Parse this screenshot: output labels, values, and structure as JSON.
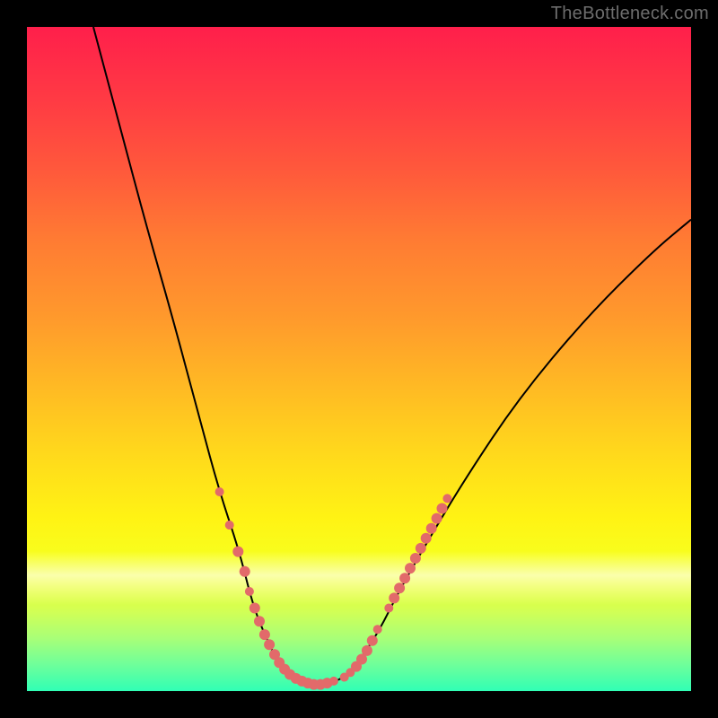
{
  "attribution": "TheBottleneck.com",
  "chart_data": {
    "type": "line",
    "title": "",
    "xlabel": "",
    "ylabel": "",
    "xlim": [
      0,
      100
    ],
    "ylim": [
      0,
      100
    ],
    "curve": {
      "name": "bottleneck-curve",
      "points": [
        {
          "x": 10,
          "y": 100
        },
        {
          "x": 14,
          "y": 85
        },
        {
          "x": 18,
          "y": 70
        },
        {
          "x": 22,
          "y": 56
        },
        {
          "x": 26,
          "y": 41
        },
        {
          "x": 29,
          "y": 30
        },
        {
          "x": 32,
          "y": 21
        },
        {
          "x": 34,
          "y": 13
        },
        {
          "x": 36,
          "y": 8
        },
        {
          "x": 38,
          "y": 4
        },
        {
          "x": 40,
          "y": 2
        },
        {
          "x": 42,
          "y": 1.3
        },
        {
          "x": 44,
          "y": 1
        },
        {
          "x": 46,
          "y": 1.3
        },
        {
          "x": 48,
          "y": 2.2
        },
        {
          "x": 50,
          "y": 4.5
        },
        {
          "x": 53,
          "y": 9
        },
        {
          "x": 56,
          "y": 15
        },
        {
          "x": 60,
          "y": 22
        },
        {
          "x": 66,
          "y": 32
        },
        {
          "x": 74,
          "y": 44
        },
        {
          "x": 84,
          "y": 56
        },
        {
          "x": 94,
          "y": 66
        },
        {
          "x": 100,
          "y": 71
        }
      ]
    },
    "markers": {
      "name": "highlight-points",
      "color": "#e26a6a",
      "points": [
        {
          "x": 29.0,
          "y": 30.0,
          "r": 5
        },
        {
          "x": 30.5,
          "y": 25.0,
          "r": 5
        },
        {
          "x": 31.8,
          "y": 21.0,
          "r": 6
        },
        {
          "x": 32.8,
          "y": 18.0,
          "r": 6
        },
        {
          "x": 33.5,
          "y": 15.0,
          "r": 5
        },
        {
          "x": 34.3,
          "y": 12.5,
          "r": 6
        },
        {
          "x": 35.0,
          "y": 10.5,
          "r": 6
        },
        {
          "x": 35.8,
          "y": 8.5,
          "r": 6
        },
        {
          "x": 36.5,
          "y": 7.0,
          "r": 6
        },
        {
          "x": 37.3,
          "y": 5.5,
          "r": 6
        },
        {
          "x": 38.0,
          "y": 4.3,
          "r": 6
        },
        {
          "x": 38.8,
          "y": 3.3,
          "r": 6
        },
        {
          "x": 39.6,
          "y": 2.5,
          "r": 6
        },
        {
          "x": 40.5,
          "y": 1.9,
          "r": 6
        },
        {
          "x": 41.4,
          "y": 1.5,
          "r": 6
        },
        {
          "x": 42.3,
          "y": 1.2,
          "r": 6
        },
        {
          "x": 43.2,
          "y": 1.0,
          "r": 6
        },
        {
          "x": 44.2,
          "y": 1.0,
          "r": 6
        },
        {
          "x": 45.2,
          "y": 1.2,
          "r": 6
        },
        {
          "x": 46.2,
          "y": 1.5,
          "r": 5
        },
        {
          "x": 47.8,
          "y": 2.1,
          "r": 5
        },
        {
          "x": 48.7,
          "y": 2.8,
          "r": 5
        },
        {
          "x": 49.6,
          "y": 3.7,
          "r": 6
        },
        {
          "x": 50.4,
          "y": 4.8,
          "r": 6
        },
        {
          "x": 51.2,
          "y": 6.1,
          "r": 6
        },
        {
          "x": 52.0,
          "y": 7.6,
          "r": 6
        },
        {
          "x": 52.8,
          "y": 9.3,
          "r": 5
        },
        {
          "x": 54.5,
          "y": 12.5,
          "r": 5
        },
        {
          "x": 55.3,
          "y": 14.0,
          "r": 6
        },
        {
          "x": 56.1,
          "y": 15.5,
          "r": 6
        },
        {
          "x": 56.9,
          "y": 17.0,
          "r": 6
        },
        {
          "x": 57.7,
          "y": 18.5,
          "r": 6
        },
        {
          "x": 58.5,
          "y": 20.0,
          "r": 6
        },
        {
          "x": 59.3,
          "y": 21.5,
          "r": 6
        },
        {
          "x": 60.1,
          "y": 23.0,
          "r": 6
        },
        {
          "x": 60.9,
          "y": 24.5,
          "r": 6
        },
        {
          "x": 61.7,
          "y": 26.0,
          "r": 6
        },
        {
          "x": 62.5,
          "y": 27.5,
          "r": 6
        },
        {
          "x": 63.3,
          "y": 29.0,
          "r": 5
        }
      ]
    },
    "background_gradient": {
      "top": "#ff1f4b",
      "bottom": "#30ffb5"
    }
  }
}
